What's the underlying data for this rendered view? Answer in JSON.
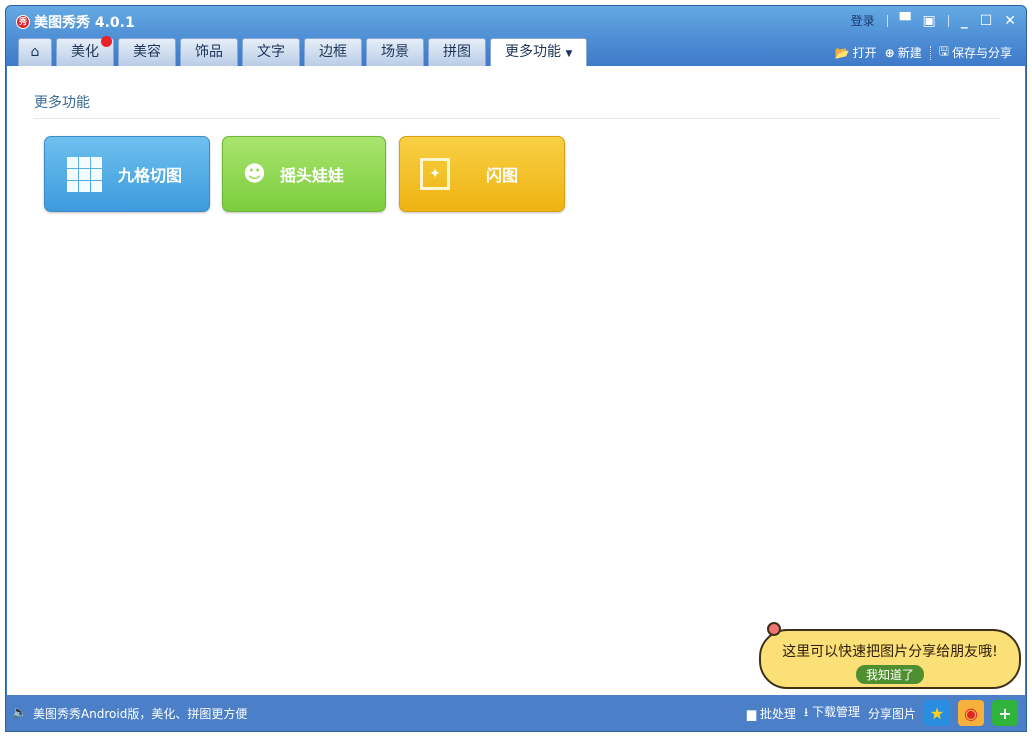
{
  "app": {
    "title": "美图秀秀 4.0.1",
    "logo_text": "秀"
  },
  "titlebar": {
    "login": "登录"
  },
  "tabs": [
    {
      "label": "美化",
      "badge": true
    },
    {
      "label": "美容"
    },
    {
      "label": "饰品"
    },
    {
      "label": "文字"
    },
    {
      "label": "边框"
    },
    {
      "label": "场景"
    },
    {
      "label": "拼图"
    },
    {
      "label": "更多功能",
      "active": true
    }
  ],
  "toolbar": {
    "open": "打开",
    "new": "新建",
    "save_share": "保存与分享"
  },
  "main": {
    "heading": "更多功能",
    "buttons": [
      {
        "label": "九格切图"
      },
      {
        "label": "摇头娃娃"
      },
      {
        "label": "闪图"
      }
    ]
  },
  "tip": {
    "text": "这里可以快速把图片分享给朋友哦!",
    "button": "我知道了"
  },
  "status": {
    "message": "美图秀秀Android版，美化、拼图更方便",
    "batch": "批处理",
    "download": "下载管理",
    "share": "分享图片"
  }
}
